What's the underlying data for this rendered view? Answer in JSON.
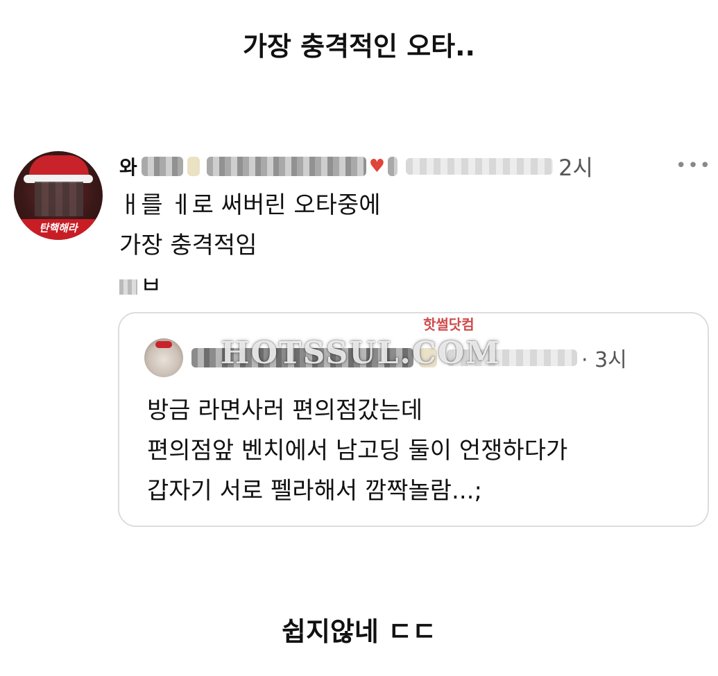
{
  "headline_top": "가장 충격적인 오타..",
  "headline_bottom": "쉽지않네 ㄷㄷ",
  "post": {
    "name_initial": "와",
    "avatar_banner": "탄핵해라",
    "time": "2시",
    "more": "•••",
    "lines": [
      "ㅐ를 ㅔ로 써버린 오타중에",
      "가장 충격적임",
      "ㅂ"
    ]
  },
  "quote": {
    "time": "· 3시",
    "lines": [
      "방금 라면사러 편의점갔는데",
      "편의점앞 벤치에서 남고딩 둘이 언쟁하다가",
      "갑자기 서로 펠라해서 깜짝놀람...;"
    ]
  },
  "watermark": {
    "korean": "핫썰닷컴",
    "latin": "HOTSSUL.COM"
  },
  "colors": {
    "heart": "#e0443a",
    "banner": "#c81d25",
    "watermark_korean": "#d04a4a"
  }
}
